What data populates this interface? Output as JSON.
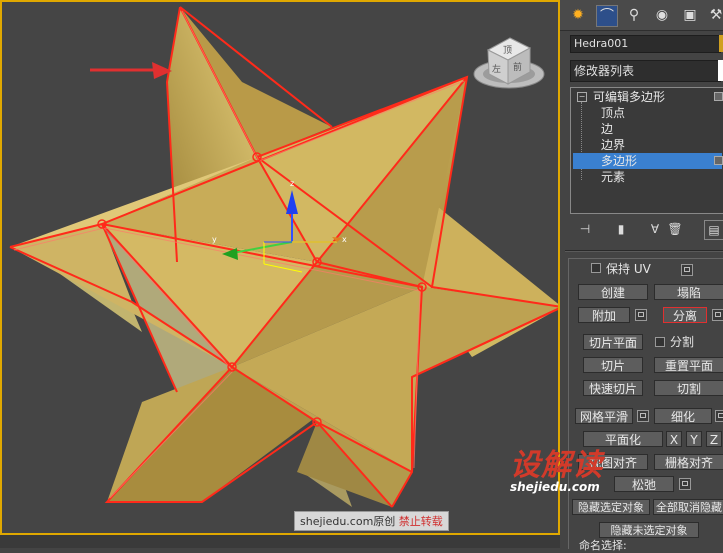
{
  "watermark": {
    "site": "shejiedu.com原创",
    "note": "禁止转载"
  },
  "logo": {
    "cn": "设解读",
    "url": "shejiedu.com"
  },
  "viewcube": {
    "top": "顶",
    "left": "左",
    "front": "前"
  },
  "gizmo": {
    "x": "x",
    "y": "y",
    "z": "z"
  },
  "object_name": "Hedra001",
  "modifier_list": "修改器列表",
  "stack": {
    "root": "可编辑多边形",
    "items": [
      "顶点",
      "边",
      "边界",
      "多边形",
      "元素"
    ],
    "selected_index": 3
  },
  "panel": {
    "keep_uv": "保持 UV",
    "create": "创建",
    "collapse": "塌陷",
    "attach": "附加",
    "detach": "分离",
    "slice_plane": "切片平面",
    "split": "分割",
    "slice": "切片",
    "reset_plane": "重置平面",
    "quickslice": "快速切片",
    "cut": "切割",
    "meshsmooth": "网格平滑",
    "tessellate": "细化",
    "make_planar": "平面化",
    "x": "X",
    "y": "Y",
    "z": "Z",
    "view_align": "视图对齐",
    "grid_align": "栅格对齐",
    "relax": "松弛",
    "hide_selected": "隐藏选定对象",
    "unhide_all": "全部取消隐藏",
    "hide_unselected": "隐藏未选定对象",
    "named_sel": "命名选择:"
  },
  "colors": {
    "face": "#c9ad55",
    "edge": "#ff2a1a",
    "selected": "#3a80d0",
    "viewport_border": "#e0a800"
  }
}
